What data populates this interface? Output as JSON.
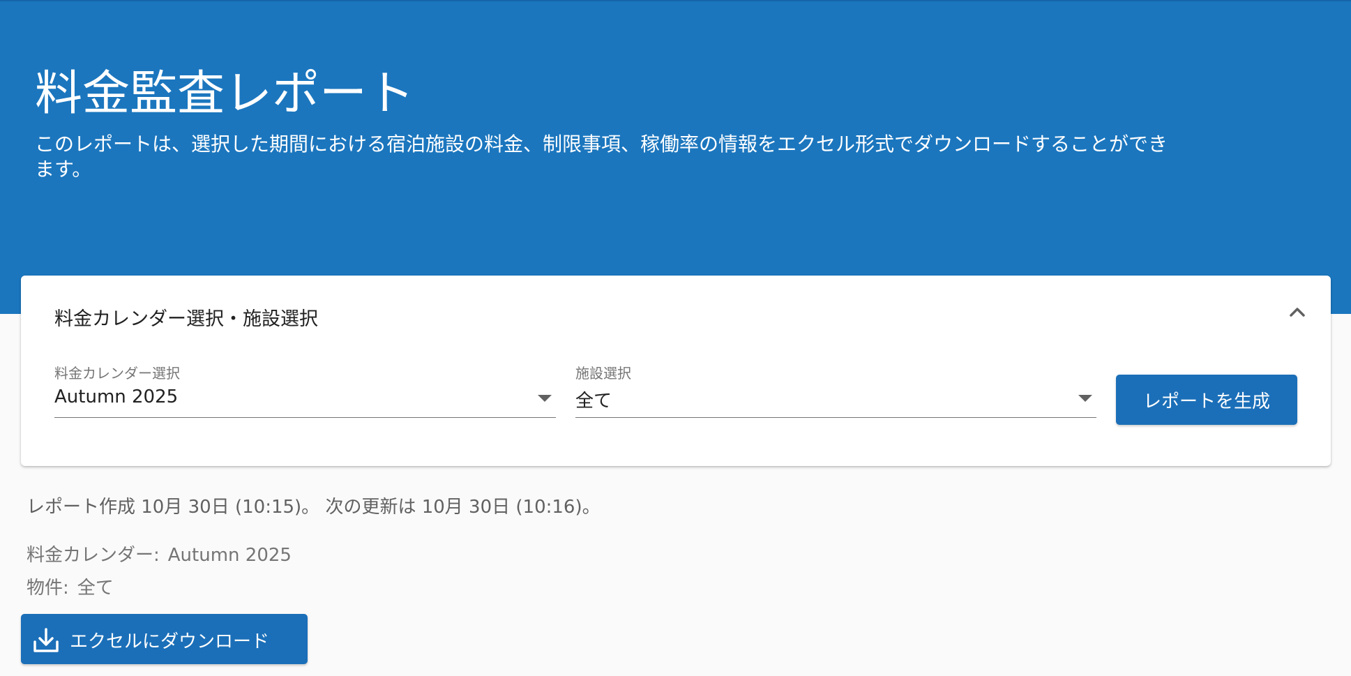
{
  "header": {
    "title": "料金監査レポート",
    "description": "このレポートは、選択した期間における宿泊施設の料金、制限事項、稼働率の情報をエクセル形式でダウンロードすることができます。",
    "background_color": "#1b76be"
  },
  "selection_card": {
    "title": "料金カレンダー選択・施設選択",
    "collapse_icon": "chevron-up-icon",
    "calendar_select": {
      "label": "料金カレンダー選択",
      "value": "Autumn 2025"
    },
    "facility_select": {
      "label": "施設選択",
      "value": "全て"
    },
    "generate_button": {
      "label": "レポートを生成",
      "color": "#1b6fb8"
    }
  },
  "report_info": {
    "status": "レポート作成 10月 30日 (10:15)。 次の更新は 10月 30日 (10:16)。",
    "calendar_label": "料金カレンダー:",
    "calendar_value": "Autumn 2025",
    "property_label": "物件:",
    "property_value": "全て"
  },
  "download_button": {
    "label": "エクセルにダウンロード",
    "icon": "download-icon"
  }
}
